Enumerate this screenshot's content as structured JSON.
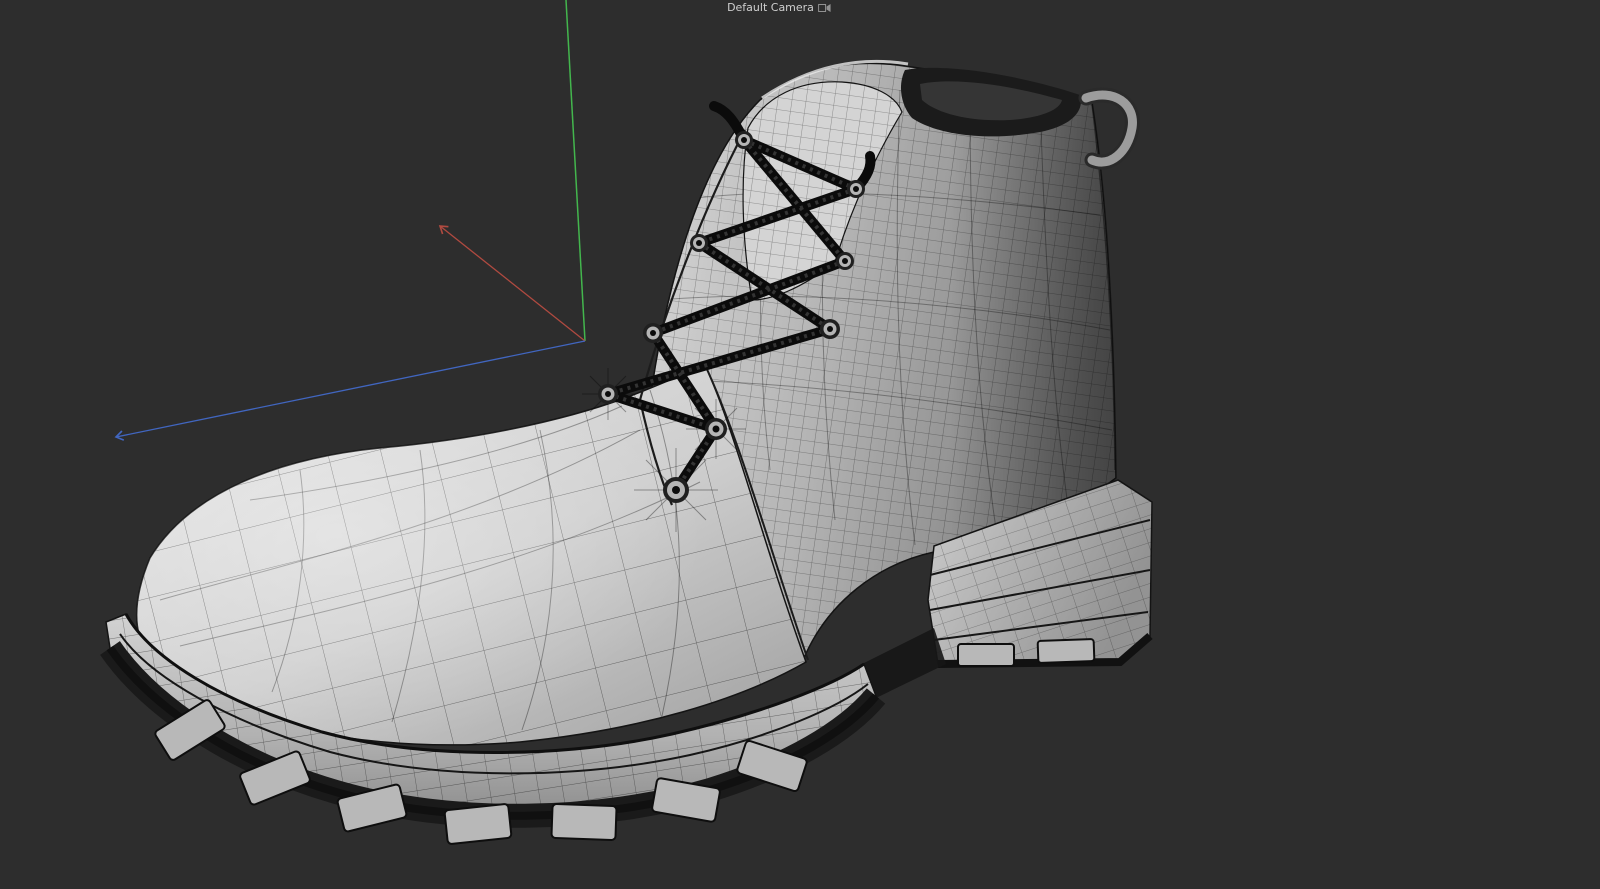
{
  "viewport": {
    "camera_label": "Default Camera",
    "background_color": "#2d2d2d",
    "label_color": "#cfcfcf"
  },
  "axes": {
    "x": {
      "color": "#b04a40"
    },
    "y": {
      "color": "#43b64d"
    },
    "z": {
      "color": "#4166c0"
    }
  },
  "model": {
    "object": "wireframe-boot-mesh",
    "surface_light": "#e2e2e2",
    "surface_mid": "#bcbcbc",
    "surface_dark": "#7f7f7f",
    "wireframe_color": "#141414",
    "lace_color": "#0b0b0b",
    "collar_interior_color": "#1b1b1b",
    "sole_tread_color": "#b8b8b8",
    "sole_gap_color": "#111111"
  }
}
